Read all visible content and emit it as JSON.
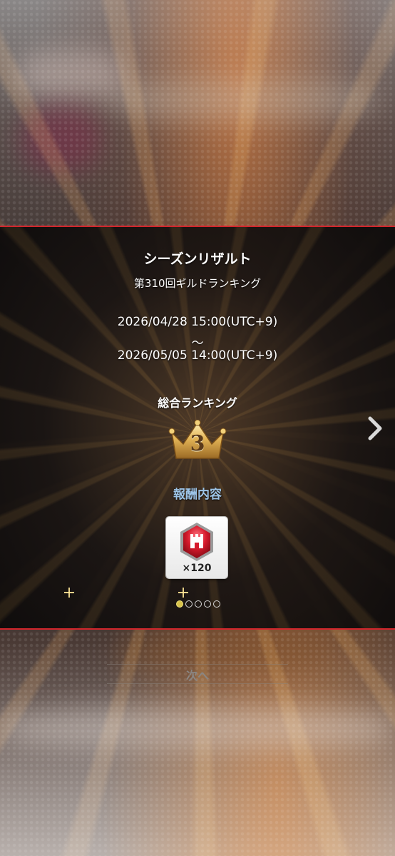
{
  "result": {
    "title": "シーズンリザルト",
    "subtitle": "第310回ギルドランキング",
    "period_start": "2026/04/28 15:00(UTC+9)",
    "period_separator": "～",
    "period_end": "2026/05/05 14:00(UTC+9)",
    "rank_label": "総合ランキング",
    "rank_value": "3",
    "reward_label": "報酬内容",
    "reward_quantity": "×120",
    "reward_icon": "red-castle-gem-icon",
    "pager_total": 5,
    "pager_active": 1
  },
  "footer": {
    "next_label": "次へ"
  },
  "colors": {
    "accent_border": "#d3262c",
    "reward_label": "#9cc3e6",
    "crown_gold": "#e3b456",
    "pager_active": "#d7c24a"
  }
}
